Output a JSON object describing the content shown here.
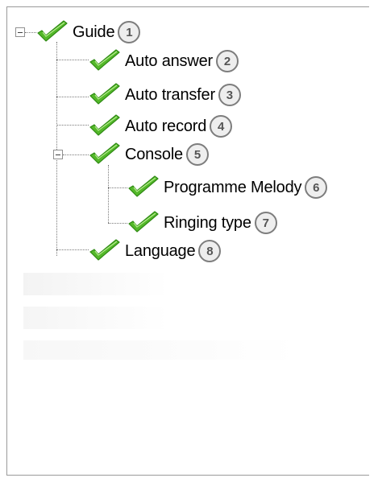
{
  "tree": {
    "root": {
      "label": "Guide",
      "badge": "1",
      "icon": "check-icon",
      "expanded": true,
      "children": [
        {
          "label": "Auto answer",
          "badge": "2",
          "icon": "check-icon"
        },
        {
          "label": "Auto transfer",
          "badge": "3",
          "icon": "check-icon"
        },
        {
          "label": "Auto record",
          "badge": "4",
          "icon": "check-icon"
        },
        {
          "label": "Console",
          "badge": "5",
          "icon": "check-icon",
          "expanded": true,
          "children": [
            {
              "label": "Programme Melody",
              "badge": "6",
              "icon": "check-icon"
            },
            {
              "label": "Ringing type",
              "badge": "7",
              "icon": "check-icon"
            }
          ]
        },
        {
          "label": "Language",
          "badge": "8",
          "icon": "check-icon"
        }
      ]
    }
  },
  "colors": {
    "check_green": "#54b82a",
    "check_dark": "#2f8a14",
    "badge_border": "#7d7d7d",
    "tree_lines": "#7a7a7a",
    "panel_border": "#9a9a9a"
  }
}
